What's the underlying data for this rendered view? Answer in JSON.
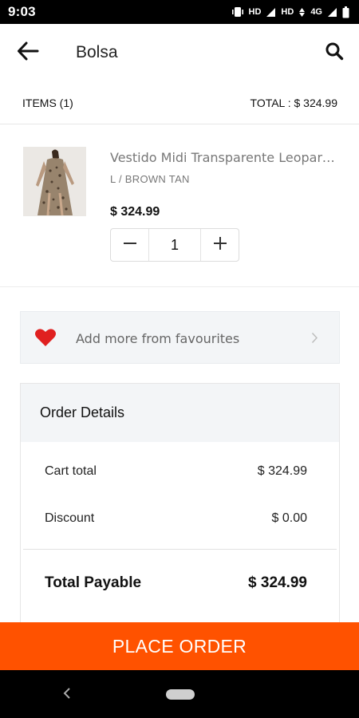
{
  "status_bar": {
    "time": "9:03",
    "hd1": "HD",
    "hd2": "HD",
    "network": "4G",
    "icons": [
      "vibrate-icon",
      "signal-icon",
      "wifi-signal-icon",
      "battery-icon"
    ]
  },
  "app_bar": {
    "title": "Bolsa",
    "back_icon": "arrow-left-icon",
    "search_icon": "search-icon"
  },
  "summary": {
    "items": "ITEMS (1)",
    "total": "TOTAL : $ 324.99"
  },
  "cart_item": {
    "name": "Vestido Midi Transparente Leopardo Midi",
    "variant": "L / BROWN TAN",
    "price": "$ 324.99",
    "quantity": "1"
  },
  "favourites": {
    "label": "Add more from favourites",
    "heart_color": "#e02020"
  },
  "order_details": {
    "heading": "Order Details",
    "cart_total_label": "Cart total",
    "cart_total_value": "$ 324.99",
    "discount_label": "Discount",
    "discount_value": "$ 0.00",
    "total_payable_label": "Total Payable",
    "total_payable_value": "$ 324.99"
  },
  "place_order": {
    "label": "PLACE ORDER",
    "color": "#ff5200"
  }
}
